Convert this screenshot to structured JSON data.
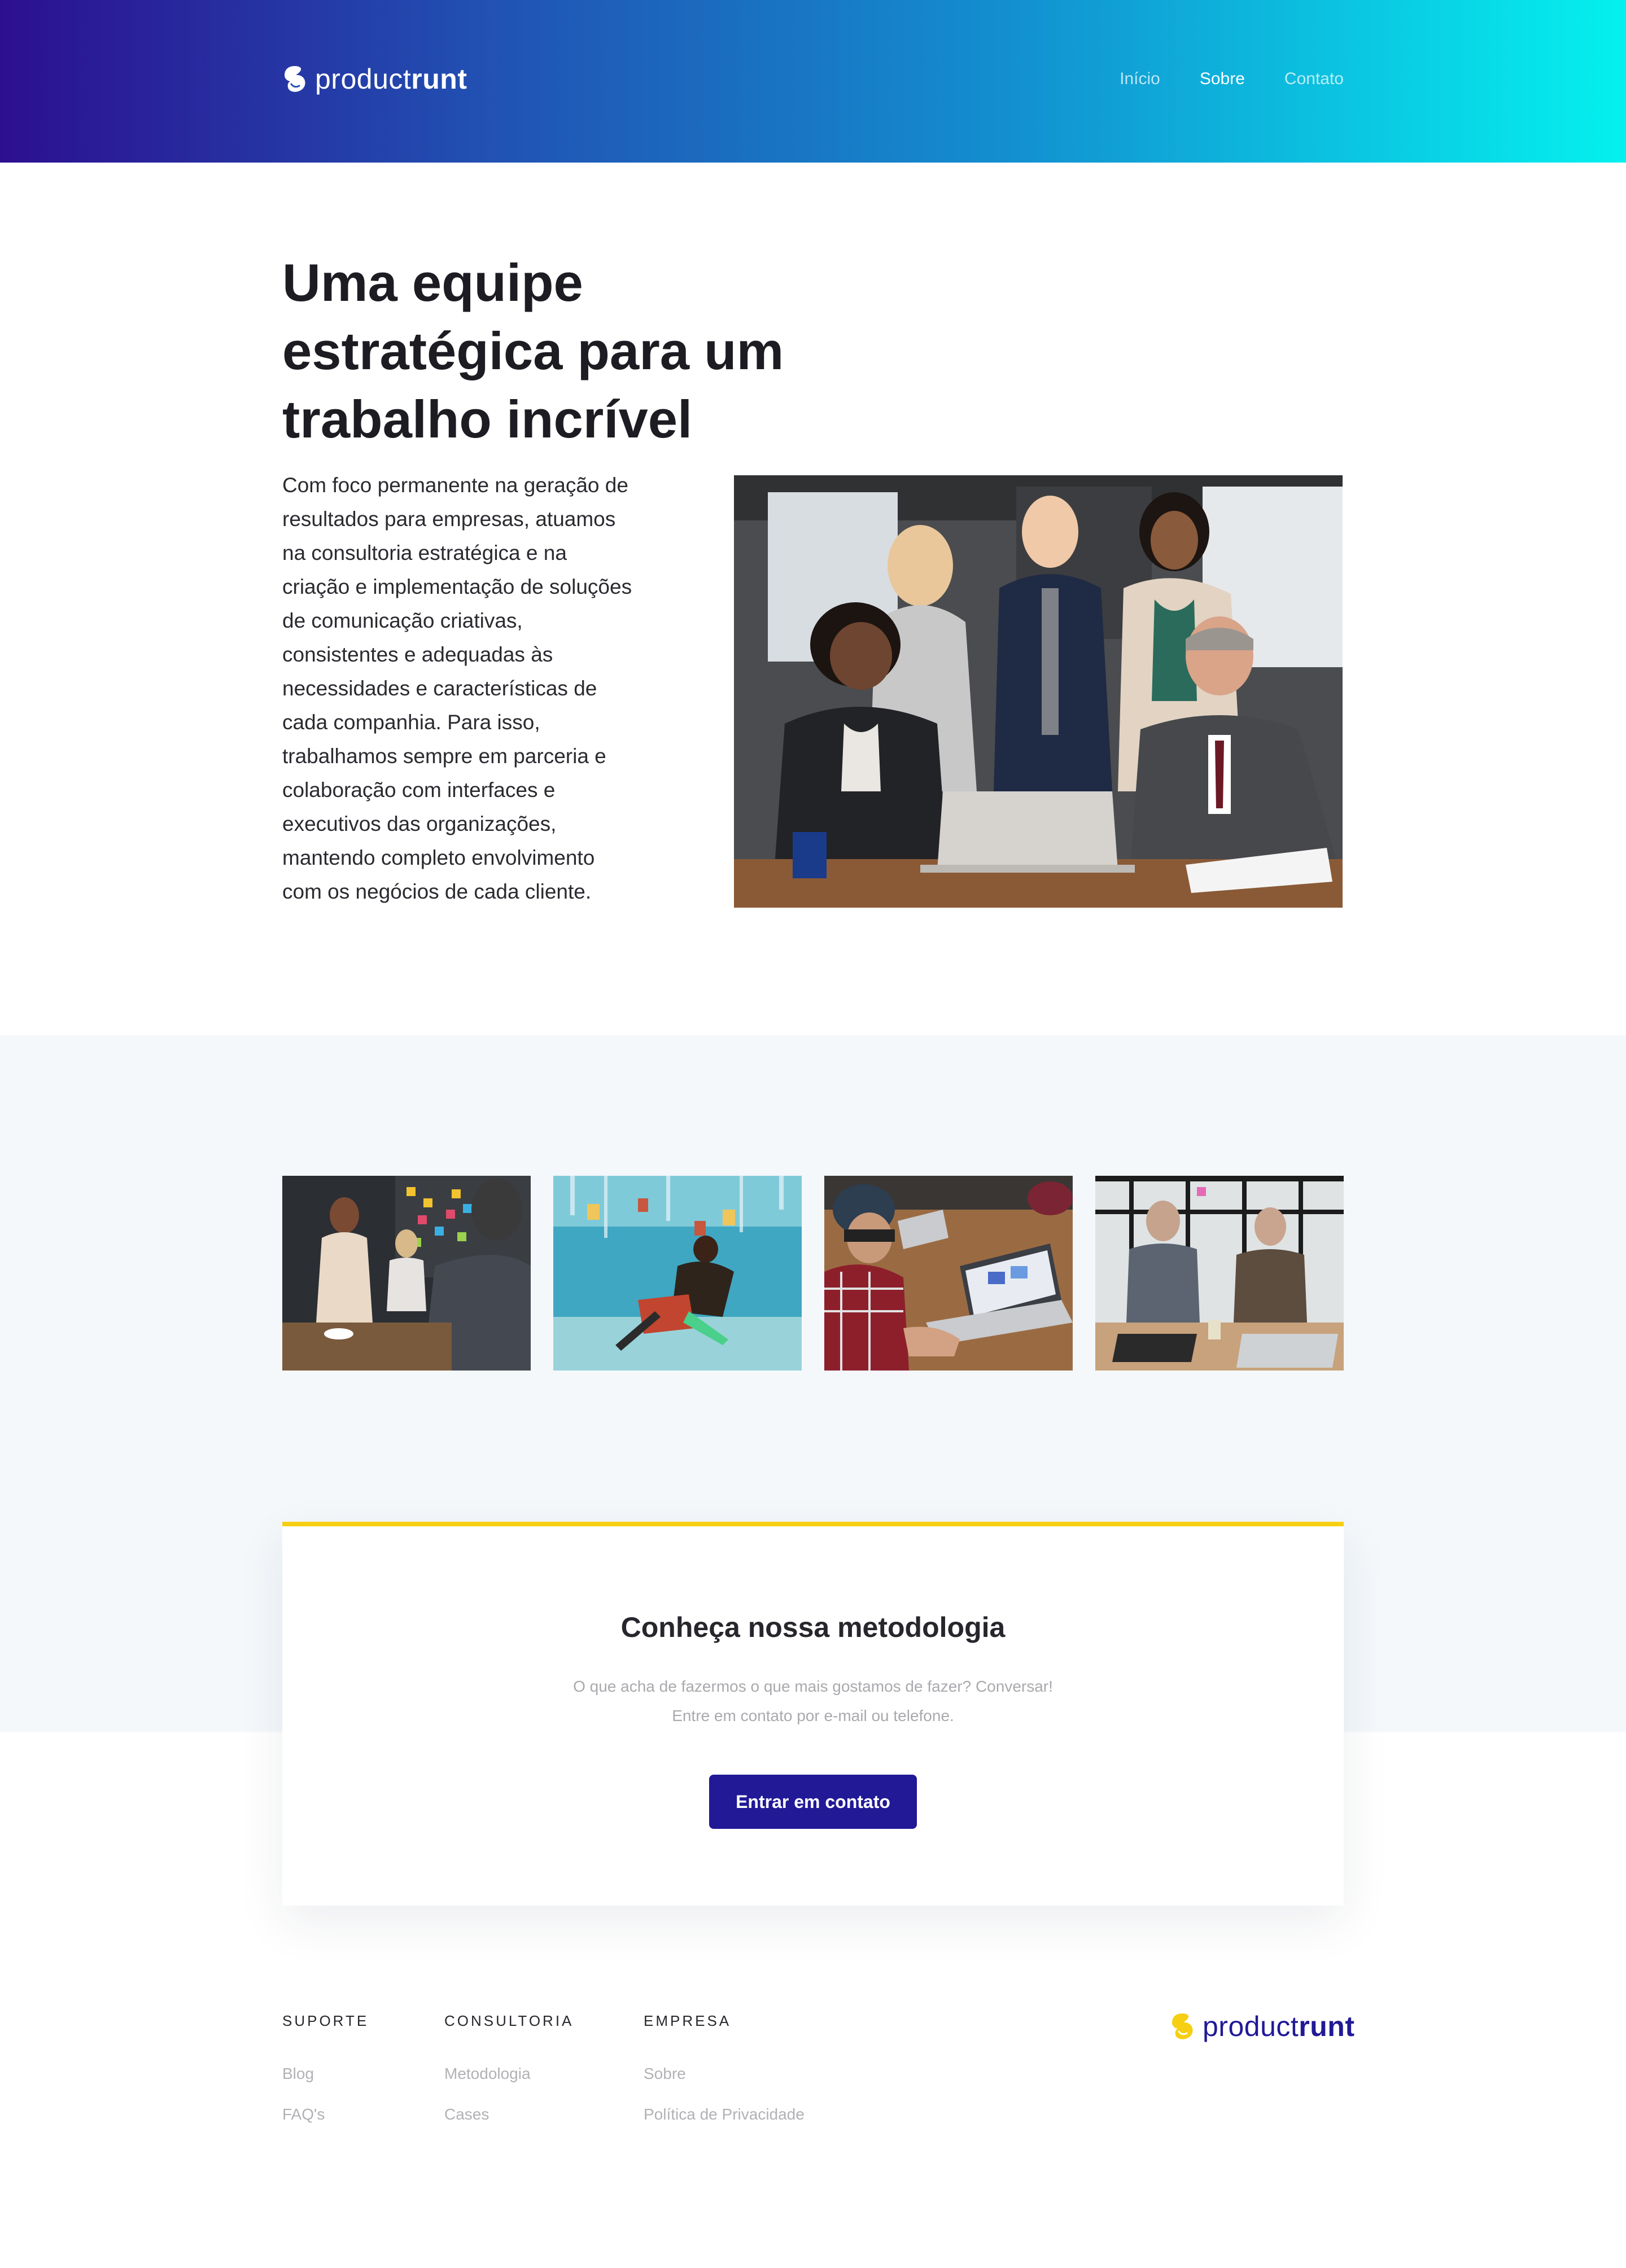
{
  "brand": {
    "name_light": "product",
    "name_bold": "runt",
    "colors": {
      "primary": "#211996",
      "accent": "#f7cf12",
      "gradient_start": "#2c0f8f",
      "gradient_end": "#04f1ef"
    }
  },
  "nav": {
    "items": [
      {
        "label": "Início"
      },
      {
        "label": "Sobre"
      },
      {
        "label": "Contato"
      }
    ],
    "active": "Sobre"
  },
  "hero": {
    "title": "Uma equipe estratégica para um trabalho incrível",
    "text": "Com foco permanente na geração de resultados para empresas, atuamos na consultoria estratégica e na criação e implementação de soluções de comunicação criativas, consistentes e adequadas às necessidades e características de cada companhia. Para isso, trabalhamos sempre em parceria e colaboração com interfaces e executivos das organizações, mantendo completo envolvimento com os negócios de cada cliente."
  },
  "cta": {
    "title": "Conheça nossa metodologia",
    "subtitle_line1": "O que acha de fazermos o que mais gostamos de fazer? Conversar!",
    "subtitle_line2": "Entre em contato por e-mail ou telefone.",
    "button": "Entrar em contato"
  },
  "footer": {
    "columns": [
      {
        "heading": "SUPORTE",
        "links": [
          "Blog",
          "FAQ's"
        ]
      },
      {
        "heading": "CONSULTORIA",
        "links": [
          "Metodologia",
          "Cases"
        ]
      },
      {
        "heading": "EMPRESA",
        "links": [
          "Sobre",
          "Política de Privacidade"
        ]
      }
    ]
  }
}
